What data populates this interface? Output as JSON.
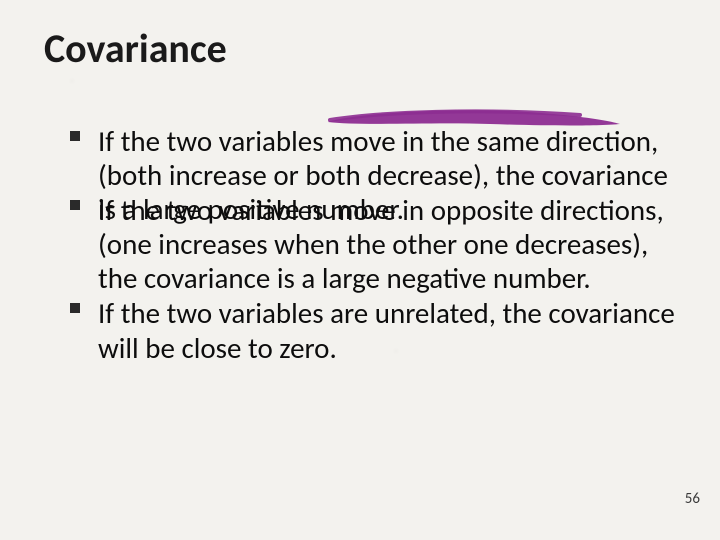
{
  "title": "Covariance",
  "bullets": [
    "If the two variables move in the same direction, (both increase or both decrease), the covariance is a large positive number.",
    "If the two variables move in opposite directions, (one increases when the other one decreases), the covariance is a large negative number.",
    "If the two variables are unrelated, the covariance will be close to zero."
  ],
  "page_number": "56",
  "accent_color": "#8d2d91"
}
